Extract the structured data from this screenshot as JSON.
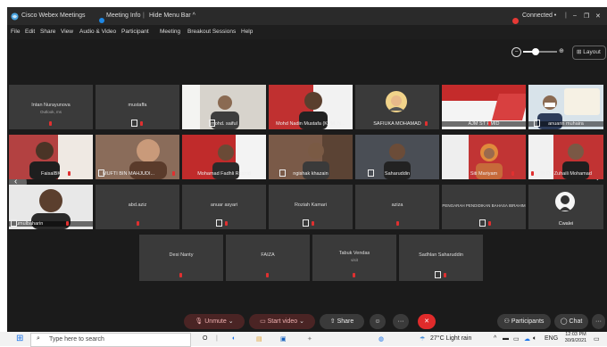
{
  "window": {
    "app_title": "Cisco Webex Meetings",
    "meeting_info": "Meeting Info",
    "hide_menu_bar": "Hide Menu Bar ^",
    "connected": "Connected •",
    "minimize_symbol": "–",
    "restore_symbol": "❐",
    "close_symbol": "✕"
  },
  "menu": [
    "File",
    "Edit",
    "Share",
    "View",
    "Audio & Video",
    "Participant",
    "Meeting",
    "Breakout Sessions",
    "Help"
  ],
  "view_controls": {
    "layout_label": "Layout",
    "zoom_level_fraction": 0.3
  },
  "participants": [
    {
      "id": "intan",
      "name": "Intan Nurayunova",
      "subtitle": "Outlook, ms"
    },
    {
      "id": "mustaffa",
      "name": "mustaffa"
    },
    {
      "id": "mohd-saiful",
      "name": "mohd. saiful"
    },
    {
      "id": "mohd-nadin",
      "name": "Mohd Nadin Mustafa (KPM, N..."
    },
    {
      "id": "saffuka",
      "name": "SAFIUKA MOHAMAD"
    },
    {
      "id": "ajm",
      "name": "AJM    ST HMID"
    },
    {
      "id": "anuarin",
      "name": "anuarin muhaira"
    },
    {
      "id": "faisal",
      "name": "FaisalBK"
    },
    {
      "id": "mufti",
      "name": "MUFTI BIN MAHJUDI..."
    },
    {
      "id": "fadhli",
      "name": "Mohamad Fadhli Rashid"
    },
    {
      "id": "ngishak",
      "name": "ngishak khazain"
    },
    {
      "id": "saharuddin",
      "name": "Saharuddin"
    },
    {
      "id": "siti",
      "name": "Siti Mariyam"
    },
    {
      "id": "zuhaili",
      "name": "Sr Dr. Zuhaili Mohamad"
    },
    {
      "id": "umul",
      "name": "umulbaharin"
    },
    {
      "id": "abd-aziz",
      "name": "abd.aziz"
    },
    {
      "id": "anuar",
      "name": "anuar asyari"
    },
    {
      "id": "roziah",
      "name": "Roziah Kamari"
    },
    {
      "id": "aziza",
      "name": "aziza"
    },
    {
      "id": "pengarah",
      "name": "PENGARAH PENDIDIKAN BAHASA IBRAHIM"
    },
    {
      "id": "cwalei",
      "name": "Cwalei"
    },
    {
      "id": "desi",
      "name": "Desi Nanty"
    },
    {
      "id": "faiza",
      "name": "FAIZA"
    },
    {
      "id": "tabuk",
      "name": "Tabuk Vendas",
      "subtitle": "visit"
    },
    {
      "id": "sadhlan",
      "name": "Sadhlan Saharuddin"
    }
  ],
  "toolbar": {
    "unmute": "Unmute",
    "start_video": "Start video",
    "share": "Share",
    "participants": "Participants",
    "chat": "Chat",
    "more": "···"
  },
  "taskbar": {
    "search_placeholder": "Type here to search",
    "weather": "27°C  Light rain",
    "language": "ENG",
    "time": "12:03 PM",
    "date": "30/9/2021"
  },
  "colors": {
    "accent_red": "#e02b2b",
    "connected_red": "#e53935",
    "tile_gray": "#3a3a3a",
    "window_bg": "#1b1b1b"
  }
}
